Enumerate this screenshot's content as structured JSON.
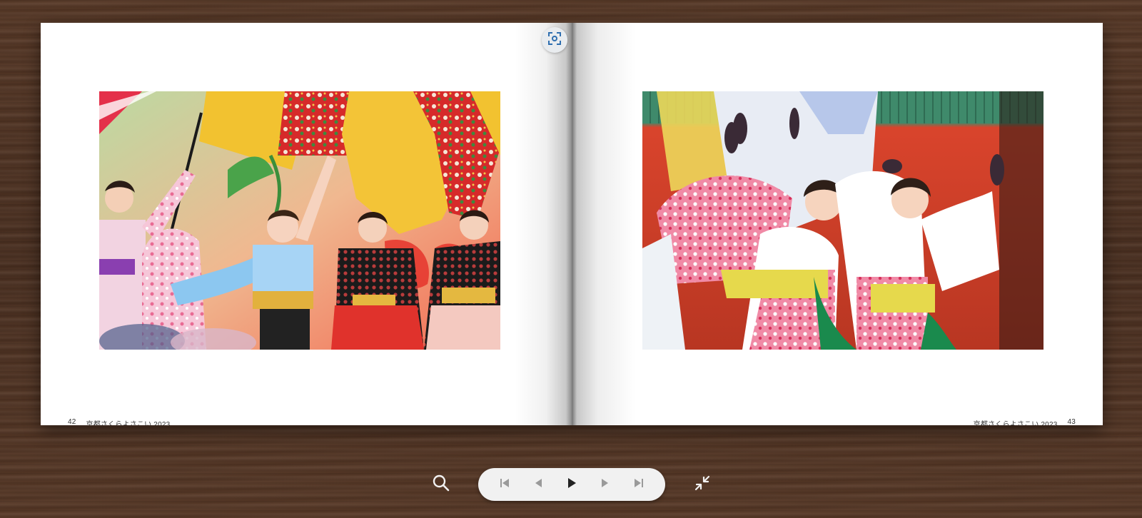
{
  "spread": {
    "left_page": {
      "page_number": "42",
      "footer_title": "京都さくらよさこい 2023"
    },
    "right_page": {
      "page_number": "43",
      "footer_title": "京都さくらよさこい 2023"
    }
  },
  "toolbar": {
    "icons": {
      "crop": "crop-focus-icon",
      "search": "search-icon",
      "first": "first-page-icon",
      "prev": "previous-page-icon",
      "play": "play-icon",
      "next": "next-page-icon",
      "last": "last-page-icon",
      "exit_fullscreen": "exit-fullscreen-icon"
    }
  },
  "colors": {
    "wood_background": "#4a2f20",
    "page": "#ffffff",
    "control_pill": "#f1f1f1",
    "icon_active": "#222222",
    "icon_muted": "#9a9a9a",
    "crop_icon": "#2f6fb0"
  }
}
